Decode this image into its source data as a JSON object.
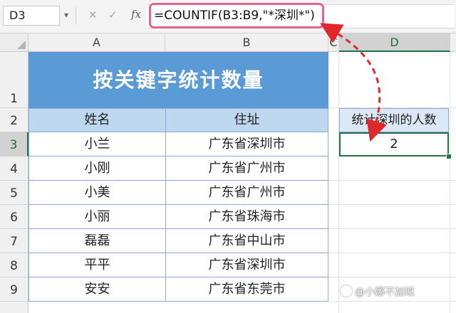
{
  "formula_bar": {
    "name_box": "D3",
    "cancel_glyph": "✕",
    "enter_glyph": "✓",
    "fx_label": "fx",
    "formula": "=COUNTIF(B3:B9,\"*深圳*\")"
  },
  "columns": [
    "A",
    "B",
    "C",
    "D"
  ],
  "rows": [
    "1",
    "2",
    "3",
    "4",
    "5",
    "6",
    "7",
    "8",
    "9"
  ],
  "sheet": {
    "title": "按关键字统计数量",
    "headers": {
      "name": "姓名",
      "address": "住址"
    },
    "records": [
      {
        "name": "小兰",
        "address": "广东省深圳市"
      },
      {
        "name": "小刚",
        "address": "广东省广州市"
      },
      {
        "name": "小美",
        "address": "广东省广州市"
      },
      {
        "name": "小丽",
        "address": "广东省珠海市"
      },
      {
        "name": "磊磊",
        "address": "广东省中山市"
      },
      {
        "name": "平平",
        "address": "广东省深圳市"
      },
      {
        "name": "安安",
        "address": "广东省东莞市"
      }
    ],
    "result_label": "统计深圳的人数",
    "result_value": "2"
  },
  "annotation": {
    "arrow_color": "#e0282c"
  },
  "watermark": "@小娜不加班",
  "colors": {
    "title_bg": "#5b9bd5",
    "header_bg": "#bdd7ee",
    "highlight_border": "#e56390",
    "selection": "#217346"
  }
}
